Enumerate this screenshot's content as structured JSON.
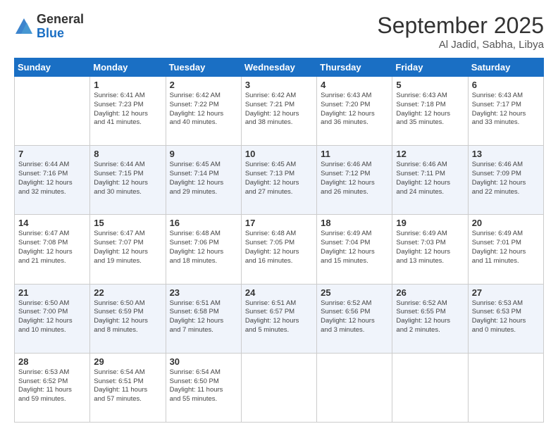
{
  "logo": {
    "general": "General",
    "blue": "Blue"
  },
  "title": "September 2025",
  "location": "Al Jadid, Sabha, Libya",
  "days_header": [
    "Sunday",
    "Monday",
    "Tuesday",
    "Wednesday",
    "Thursday",
    "Friday",
    "Saturday"
  ],
  "weeks": [
    [
      {
        "day": "",
        "info": ""
      },
      {
        "day": "1",
        "info": "Sunrise: 6:41 AM\nSunset: 7:23 PM\nDaylight: 12 hours\nand 41 minutes."
      },
      {
        "day": "2",
        "info": "Sunrise: 6:42 AM\nSunset: 7:22 PM\nDaylight: 12 hours\nand 40 minutes."
      },
      {
        "day": "3",
        "info": "Sunrise: 6:42 AM\nSunset: 7:21 PM\nDaylight: 12 hours\nand 38 minutes."
      },
      {
        "day": "4",
        "info": "Sunrise: 6:43 AM\nSunset: 7:20 PM\nDaylight: 12 hours\nand 36 minutes."
      },
      {
        "day": "5",
        "info": "Sunrise: 6:43 AM\nSunset: 7:18 PM\nDaylight: 12 hours\nand 35 minutes."
      },
      {
        "day": "6",
        "info": "Sunrise: 6:43 AM\nSunset: 7:17 PM\nDaylight: 12 hours\nand 33 minutes."
      }
    ],
    [
      {
        "day": "7",
        "info": "Sunrise: 6:44 AM\nSunset: 7:16 PM\nDaylight: 12 hours\nand 32 minutes."
      },
      {
        "day": "8",
        "info": "Sunrise: 6:44 AM\nSunset: 7:15 PM\nDaylight: 12 hours\nand 30 minutes."
      },
      {
        "day": "9",
        "info": "Sunrise: 6:45 AM\nSunset: 7:14 PM\nDaylight: 12 hours\nand 29 minutes."
      },
      {
        "day": "10",
        "info": "Sunrise: 6:45 AM\nSunset: 7:13 PM\nDaylight: 12 hours\nand 27 minutes."
      },
      {
        "day": "11",
        "info": "Sunrise: 6:46 AM\nSunset: 7:12 PM\nDaylight: 12 hours\nand 26 minutes."
      },
      {
        "day": "12",
        "info": "Sunrise: 6:46 AM\nSunset: 7:11 PM\nDaylight: 12 hours\nand 24 minutes."
      },
      {
        "day": "13",
        "info": "Sunrise: 6:46 AM\nSunset: 7:09 PM\nDaylight: 12 hours\nand 22 minutes."
      }
    ],
    [
      {
        "day": "14",
        "info": "Sunrise: 6:47 AM\nSunset: 7:08 PM\nDaylight: 12 hours\nand 21 minutes."
      },
      {
        "day": "15",
        "info": "Sunrise: 6:47 AM\nSunset: 7:07 PM\nDaylight: 12 hours\nand 19 minutes."
      },
      {
        "day": "16",
        "info": "Sunrise: 6:48 AM\nSunset: 7:06 PM\nDaylight: 12 hours\nand 18 minutes."
      },
      {
        "day": "17",
        "info": "Sunrise: 6:48 AM\nSunset: 7:05 PM\nDaylight: 12 hours\nand 16 minutes."
      },
      {
        "day": "18",
        "info": "Sunrise: 6:49 AM\nSunset: 7:04 PM\nDaylight: 12 hours\nand 15 minutes."
      },
      {
        "day": "19",
        "info": "Sunrise: 6:49 AM\nSunset: 7:03 PM\nDaylight: 12 hours\nand 13 minutes."
      },
      {
        "day": "20",
        "info": "Sunrise: 6:49 AM\nSunset: 7:01 PM\nDaylight: 12 hours\nand 11 minutes."
      }
    ],
    [
      {
        "day": "21",
        "info": "Sunrise: 6:50 AM\nSunset: 7:00 PM\nDaylight: 12 hours\nand 10 minutes."
      },
      {
        "day": "22",
        "info": "Sunrise: 6:50 AM\nSunset: 6:59 PM\nDaylight: 12 hours\nand 8 minutes."
      },
      {
        "day": "23",
        "info": "Sunrise: 6:51 AM\nSunset: 6:58 PM\nDaylight: 12 hours\nand 7 minutes."
      },
      {
        "day": "24",
        "info": "Sunrise: 6:51 AM\nSunset: 6:57 PM\nDaylight: 12 hours\nand 5 minutes."
      },
      {
        "day": "25",
        "info": "Sunrise: 6:52 AM\nSunset: 6:56 PM\nDaylight: 12 hours\nand 3 minutes."
      },
      {
        "day": "26",
        "info": "Sunrise: 6:52 AM\nSunset: 6:55 PM\nDaylight: 12 hours\nand 2 minutes."
      },
      {
        "day": "27",
        "info": "Sunrise: 6:53 AM\nSunset: 6:53 PM\nDaylight: 12 hours\nand 0 minutes."
      }
    ],
    [
      {
        "day": "28",
        "info": "Sunrise: 6:53 AM\nSunset: 6:52 PM\nDaylight: 11 hours\nand 59 minutes."
      },
      {
        "day": "29",
        "info": "Sunrise: 6:54 AM\nSunset: 6:51 PM\nDaylight: 11 hours\nand 57 minutes."
      },
      {
        "day": "30",
        "info": "Sunrise: 6:54 AM\nSunset: 6:50 PM\nDaylight: 11 hours\nand 55 minutes."
      },
      {
        "day": "",
        "info": ""
      },
      {
        "day": "",
        "info": ""
      },
      {
        "day": "",
        "info": ""
      },
      {
        "day": "",
        "info": ""
      }
    ]
  ]
}
